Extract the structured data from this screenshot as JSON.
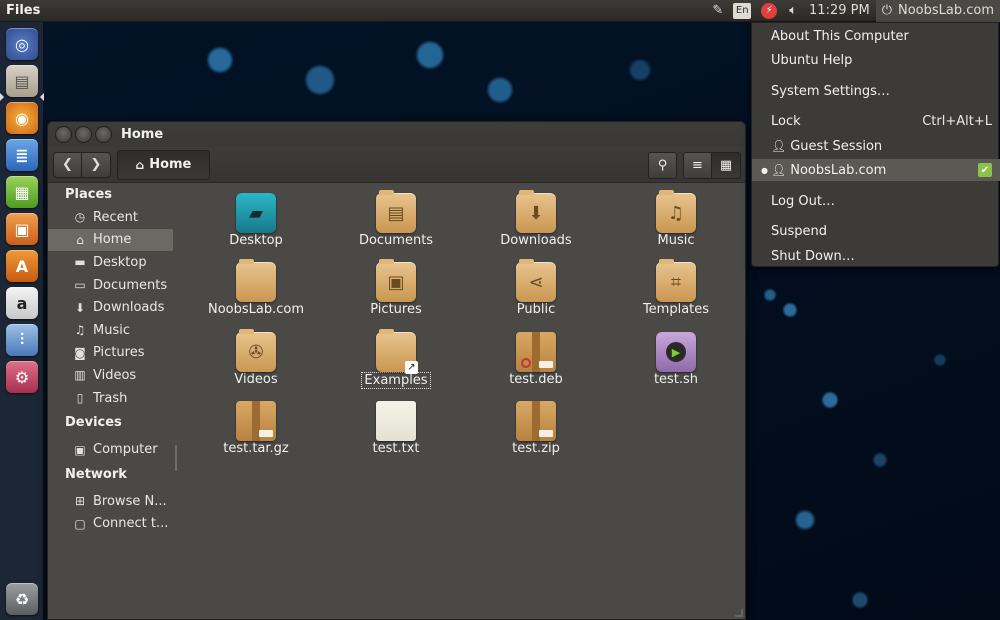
{
  "panel": {
    "app_title": "Files",
    "keyboard_layout": "En",
    "time": "11:29 PM",
    "session_label": "NoobsLab.com"
  },
  "launcher": {
    "items": [
      "dash-icon",
      "files-icon",
      "firefox-icon",
      "writer-icon",
      "calc-icon",
      "impress-icon",
      "software-center-icon",
      "amazon-icon",
      "system-monitor-icon",
      "system-settings-icon",
      "trash-icon"
    ],
    "amazon_letter": "a"
  },
  "window": {
    "title": "Home",
    "path_label": "Home",
    "sidebar": {
      "places_header": "Places",
      "places": [
        "Recent",
        "Home",
        "Desktop",
        "Documents",
        "Downloads",
        "Music",
        "Pictures",
        "Videos",
        "Trash"
      ],
      "devices_header": "Devices",
      "devices": [
        "Computer"
      ],
      "network_header": "Network",
      "network": [
        "Browse N...",
        "Connect t..."
      ]
    },
    "files": [
      {
        "name": "Desktop",
        "icon": "desktop-icon"
      },
      {
        "name": "Documents",
        "icon": "documents-folder-icon"
      },
      {
        "name": "Downloads",
        "icon": "downloads-folder-icon"
      },
      {
        "name": "Music",
        "icon": "music-folder-icon"
      },
      {
        "name": "NoobsLab.com",
        "icon": "folder-icon"
      },
      {
        "name": "Pictures",
        "icon": "pictures-folder-icon"
      },
      {
        "name": "Public",
        "icon": "public-folder-icon"
      },
      {
        "name": "Templates",
        "icon": "templates-folder-icon"
      },
      {
        "name": "Videos",
        "icon": "videos-folder-icon"
      },
      {
        "name": "Examples",
        "icon": "examples-link-folder-icon"
      },
      {
        "name": "test.deb",
        "icon": "deb-package-icon"
      },
      {
        "name": "test.sh",
        "icon": "script-icon"
      },
      {
        "name": "test.tar.gz",
        "icon": "archive-icon"
      },
      {
        "name": "test.txt",
        "icon": "text-file-icon"
      },
      {
        "name": "test.zip",
        "icon": "zip-archive-icon"
      }
    ]
  },
  "session_menu": {
    "about": "About This Computer",
    "help": "Ubuntu Help",
    "settings": "System Settings…",
    "lock": "Lock",
    "lock_accel": "Ctrl+Alt+L",
    "guest": "Guest Session",
    "current_user": "NoobsLab.com",
    "logout": "Log Out…",
    "suspend": "Suspend",
    "shutdown": "Shut Down…"
  }
}
